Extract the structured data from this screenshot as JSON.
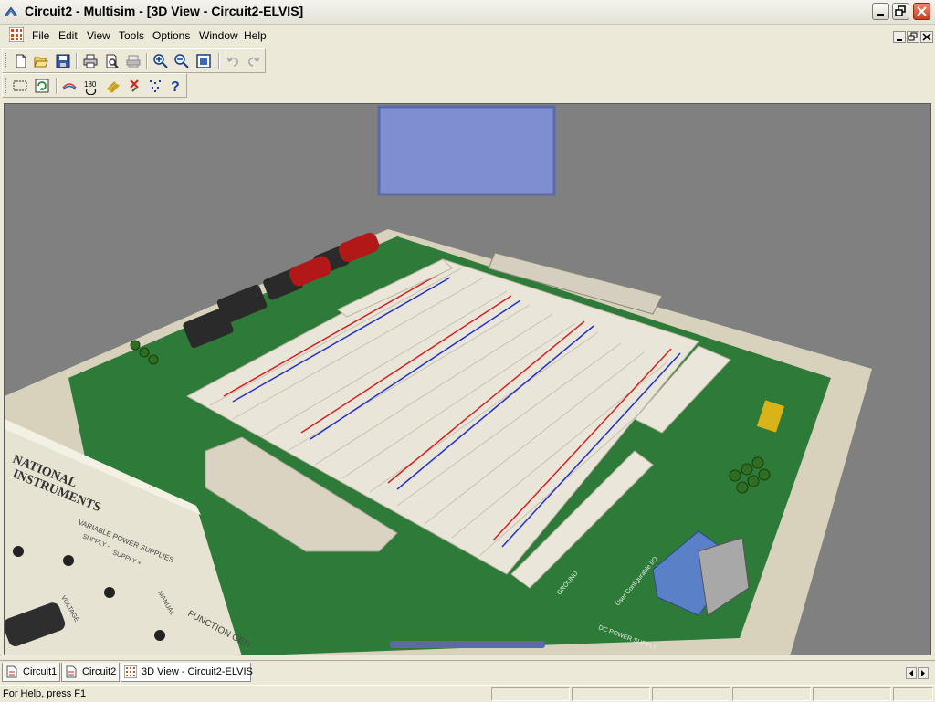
{
  "window": {
    "title": "Circuit2 - Multisim - [3D View - Circuit2-ELVIS]"
  },
  "menu": {
    "items": [
      {
        "label": "File"
      },
      {
        "label": "Edit"
      },
      {
        "label": "View"
      },
      {
        "label": "Tools"
      },
      {
        "label": "Options"
      },
      {
        "label": "Window"
      },
      {
        "label": "Help"
      }
    ]
  },
  "toolbar_main": {
    "buttons": [
      "new-file-icon",
      "open-folder-icon",
      "save-icon",
      "print-icon",
      "print-preview-icon",
      "print-circuit-icon",
      "zoom-in-icon",
      "zoom-out-icon",
      "zoom-fit-icon",
      "undo-icon",
      "redo-icon"
    ]
  },
  "toolbar_3d": {
    "buttons": [
      "select-region-icon",
      "refresh-icon",
      "wire-icon",
      "rotate-180-icon",
      "components-icon",
      "delete-marker-icon",
      "snap-icon",
      "help-icon"
    ],
    "rotate_label": "180"
  },
  "board": {
    "brand_line1": "NATIONAL",
    "brand_line2": "INSTRUMENTS",
    "panel_label_power": "VARIABLE POWER SUPPLIES",
    "panel_label_supply_minus": "SUPPLY -",
    "panel_label_supply_plus": "SUPPLY +",
    "panel_label_voltage": "VOLTAGE",
    "panel_label_manual": "MANUAL",
    "panel_label_function": "FUNCTION GEN",
    "label_dc_power": "DC POWER SUPPLY",
    "label_user_configurable": "User Configurable I/O",
    "label_ground": "GROUND"
  },
  "tabs": [
    {
      "label": "Circuit1",
      "active": false
    },
    {
      "label": "Circuit2",
      "active": false
    },
    {
      "label": "3D View - Circuit2-ELVIS",
      "active": true
    }
  ],
  "status": {
    "help_text": "For Help, press F1"
  },
  "colors": {
    "viewport_bg": "#7f7f7f",
    "pcb_green": "#2f7a3a",
    "breadboard": "#e6e2d6",
    "rail_red": "#d42020",
    "rail_blue": "#2030c8",
    "display_blue": "#8393d4"
  }
}
